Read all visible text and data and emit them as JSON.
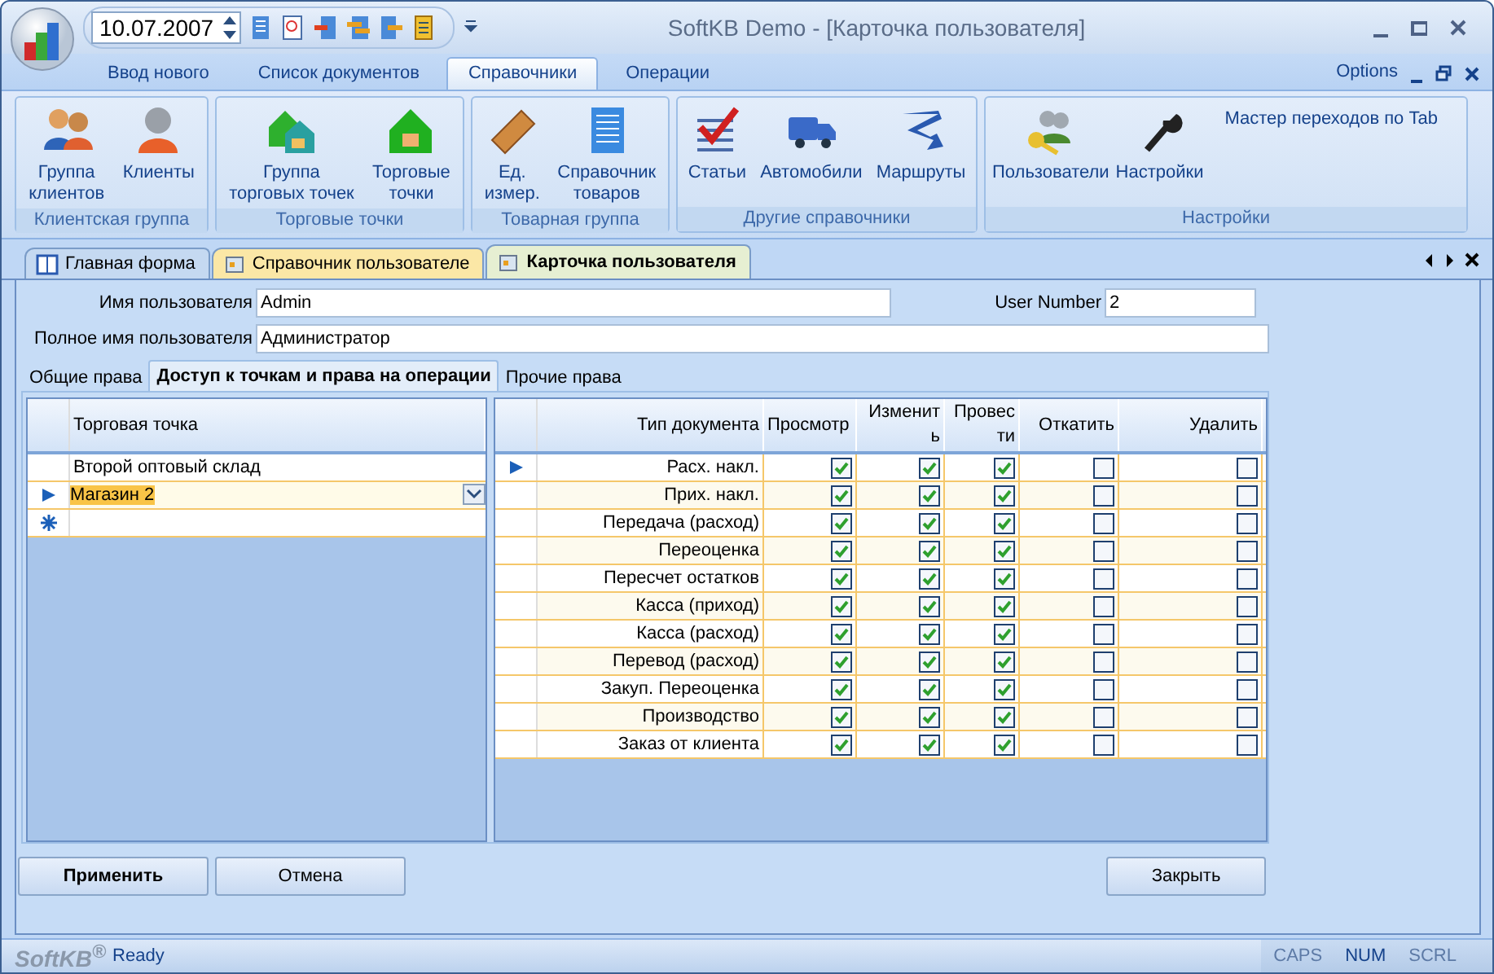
{
  "window": {
    "title": "SoftKB Demo - [Карточка пользователя]"
  },
  "quick_access": {
    "date": "10.07.2007"
  },
  "ribbon_tabs": [
    {
      "label": "Ввод нового",
      "selected": false
    },
    {
      "label": "Список документов",
      "selected": false
    },
    {
      "label": "Справочники",
      "selected": true
    },
    {
      "label": "Операции",
      "selected": false
    }
  ],
  "options_menu": "Options",
  "ribbon_groups": [
    {
      "label": "Клиентская группа",
      "buttons": [
        "Группа\nклиентов",
        "Клиенты"
      ]
    },
    {
      "label": "Торговые точки",
      "buttons": [
        "Группа\nторговых точек",
        "Торговые\nточки"
      ]
    },
    {
      "label": "Товарная группа",
      "buttons": [
        "Ед.\nизмер.",
        "Справочник\nтоваров"
      ]
    },
    {
      "label": "Другие справочники",
      "buttons": [
        "Статьи",
        "Автомобили",
        "Маршруты"
      ]
    },
    {
      "label": "Настройки",
      "buttons": [
        "Пользователи",
        "Настройки"
      ],
      "link": "Мастер переходов по Tab"
    }
  ],
  "doc_tabs": [
    {
      "label": "Главная форма",
      "selected": false,
      "color": "#c5d9f1"
    },
    {
      "label": "Справочник пользователе",
      "selected": false,
      "color": "#fbe7a6"
    },
    {
      "label": "Карточка пользователя",
      "selected": true,
      "color": "#e6efd2"
    }
  ],
  "form": {
    "user_name": {
      "label": "Имя пользователя",
      "value": "Admin"
    },
    "user_number": {
      "label": "User Number",
      "value": "2"
    },
    "full_name": {
      "label": "Полное имя пользователя",
      "value": "Администратор"
    }
  },
  "sub_tabs": [
    {
      "label": "Общие права",
      "selected": false
    },
    {
      "label": "Доступ к точкам и права на операции",
      "selected": true
    },
    {
      "label": "Прочие права",
      "selected": false
    }
  ],
  "points_grid": {
    "column": "Торговая точка",
    "rows": [
      {
        "name": "Второй оптовый склад",
        "current": false,
        "editing": false
      },
      {
        "name": "Магазин 2",
        "current": true,
        "editing": true
      }
    ]
  },
  "rights_grid": {
    "columns": [
      "Тип документа",
      "Просмотр",
      "Изменить",
      "Провести",
      "Откатить",
      "Удалить"
    ],
    "rows": [
      {
        "doc": "Расх. накл.",
        "current": true,
        "checks": [
          true,
          true,
          true,
          false,
          false
        ]
      },
      {
        "doc": "Прих. накл.",
        "current": false,
        "checks": [
          true,
          true,
          true,
          false,
          false
        ]
      },
      {
        "doc": "Передача (расход)",
        "current": false,
        "checks": [
          true,
          true,
          true,
          false,
          false
        ]
      },
      {
        "doc": "Переоценка",
        "current": false,
        "checks": [
          true,
          true,
          true,
          false,
          false
        ]
      },
      {
        "doc": "Пересчет остатков",
        "current": false,
        "checks": [
          true,
          true,
          true,
          false,
          false
        ]
      },
      {
        "doc": "Касса (приход)",
        "current": false,
        "checks": [
          true,
          true,
          true,
          false,
          false
        ]
      },
      {
        "doc": "Касса (расход)",
        "current": false,
        "checks": [
          true,
          true,
          true,
          false,
          false
        ]
      },
      {
        "doc": "Перевод (расход)",
        "current": false,
        "checks": [
          true,
          true,
          true,
          false,
          false
        ]
      },
      {
        "doc": "Закуп. Переоценка",
        "current": false,
        "checks": [
          true,
          true,
          true,
          false,
          false
        ]
      },
      {
        "doc": "Производство",
        "current": false,
        "checks": [
          true,
          true,
          true,
          false,
          false
        ]
      },
      {
        "doc": "Заказ от клиента",
        "current": false,
        "checks": [
          true,
          true,
          true,
          false,
          false
        ]
      }
    ]
  },
  "buttons": [
    {
      "label": "Применить",
      "default": true
    },
    {
      "label": "Отмена",
      "default": false
    },
    {
      "label": "Закрыть",
      "default": false
    }
  ],
  "status_bar": {
    "logo": "SoftKB",
    "logo_mark": "®",
    "text": "Ready",
    "indicators": [
      {
        "label": "CAPS",
        "on": false
      },
      {
        "label": "NUM",
        "on": true
      },
      {
        "label": "SCRL",
        "on": false
      }
    ]
  }
}
